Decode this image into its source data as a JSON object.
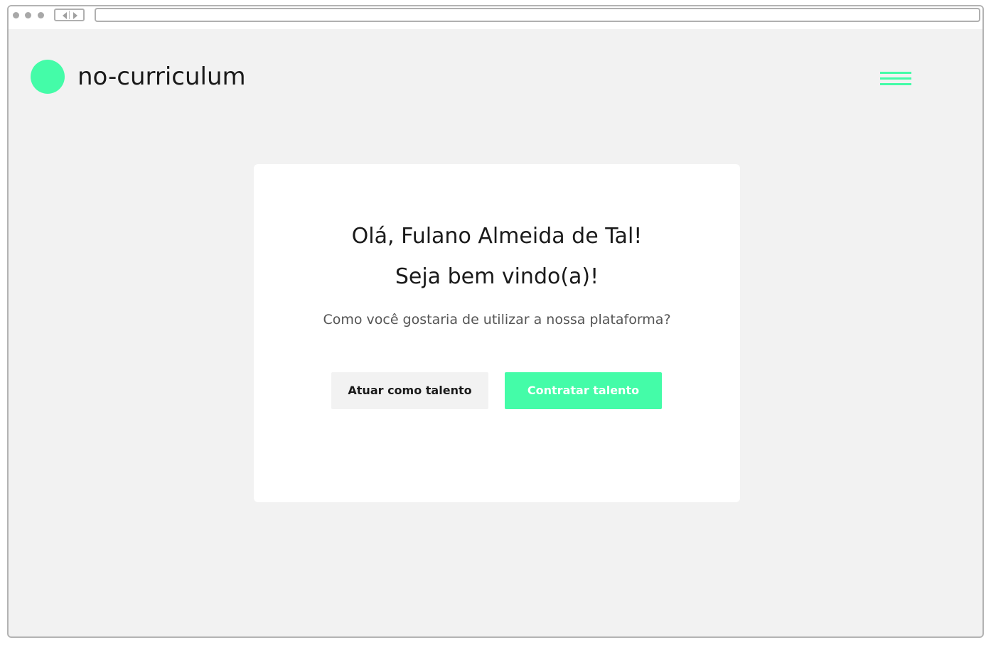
{
  "header": {
    "brand": "no-curriculum"
  },
  "card": {
    "greeting": "Olá, Fulano Almeida de Tal!",
    "welcome": "Seja bem vindo(a)!",
    "question": "Como você gostaria de utilizar a nossa plataforma?",
    "talent_button": "Atuar como talento",
    "hire_button": "Contratar talento"
  },
  "icons": {
    "logo": "circle-logo-icon",
    "menu": "hamburger-menu-icon"
  },
  "colors": {
    "accent": "#44fca8",
    "background": "#f2f2f2",
    "card": "#ffffff",
    "text": "#1a1a1a",
    "muted_text": "#555555"
  }
}
